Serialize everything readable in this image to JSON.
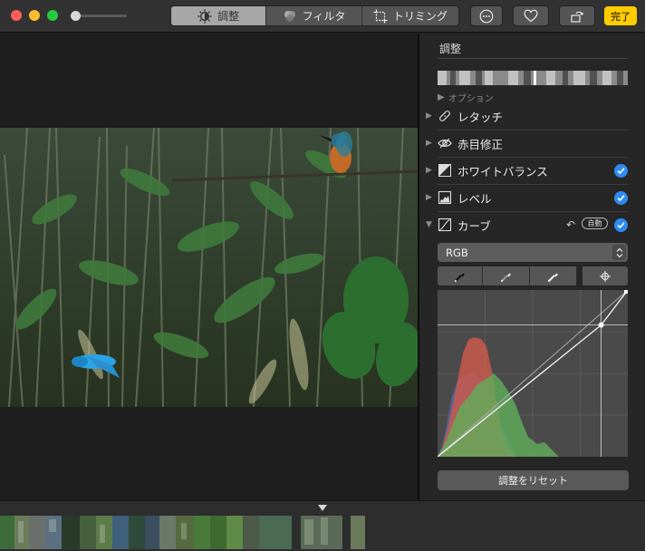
{
  "toolbar": {
    "tabs": [
      {
        "label": "調整",
        "icon": "sun-dial-icon",
        "active": true
      },
      {
        "label": "フィルタ",
        "icon": "filter-circles-icon",
        "active": false
      },
      {
        "label": "トリミング",
        "icon": "crop-icon",
        "active": false
      }
    ],
    "done_label": "完了",
    "done_color": "#ffcc00"
  },
  "panel": {
    "title": "調整",
    "options_label": "オプション",
    "sections": [
      {
        "label": "レタッチ",
        "icon": "bandage-icon",
        "checked": false,
        "expanded": false
      },
      {
        "label": "赤目修正",
        "icon": "eye-icon",
        "checked": false,
        "expanded": false
      },
      {
        "label": "ホワイトバランス",
        "icon": "white-balance-icon",
        "checked": true,
        "expanded": false
      },
      {
        "label": "レベル",
        "icon": "levels-icon",
        "checked": true,
        "expanded": false
      },
      {
        "label": "カーブ",
        "icon": "curves-icon",
        "checked": true,
        "expanded": true
      }
    ],
    "curves": {
      "auto_label": "自動",
      "channel_value": "RGB",
      "pickers": [
        "black-point-picker-icon",
        "gray-point-picker-icon",
        "white-point-picker-icon",
        "add-point-crosshair-icon"
      ],
      "point": {
        "input": 0.86,
        "output": 0.79
      }
    },
    "reset_label": "調整をリセット",
    "accent_color": "#2e8cf0"
  }
}
